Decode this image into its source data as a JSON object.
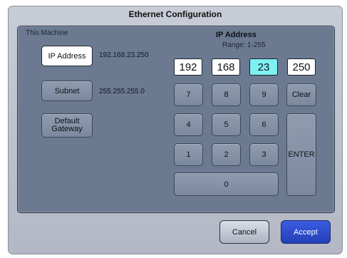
{
  "window": {
    "title": "Ethernet Configuration"
  },
  "left": {
    "section_label": "This Machine",
    "ip_button": "IP Address",
    "ip_value": "192.168.23.250",
    "subnet_button": "Subnet",
    "subnet_value": "255.255.255.0",
    "gateway_button_line1": "Default",
    "gateway_button_line2": "Gateway"
  },
  "editor": {
    "title": "IP Address",
    "range": "Range: 1-255",
    "octets": [
      "192",
      "168",
      "23",
      "250"
    ],
    "active_octet_index": 2
  },
  "keypad": {
    "keys": [
      "7",
      "8",
      "9",
      "4",
      "5",
      "6",
      "1",
      "2",
      "3",
      "0"
    ],
    "clear": "Clear",
    "enter": "ENTER"
  },
  "footer": {
    "cancel": "Cancel",
    "accept": "Accept"
  },
  "colors": {
    "panel": "#6b7a91",
    "active_field": "#7ff0f2",
    "accept": "#2f4fd0"
  }
}
